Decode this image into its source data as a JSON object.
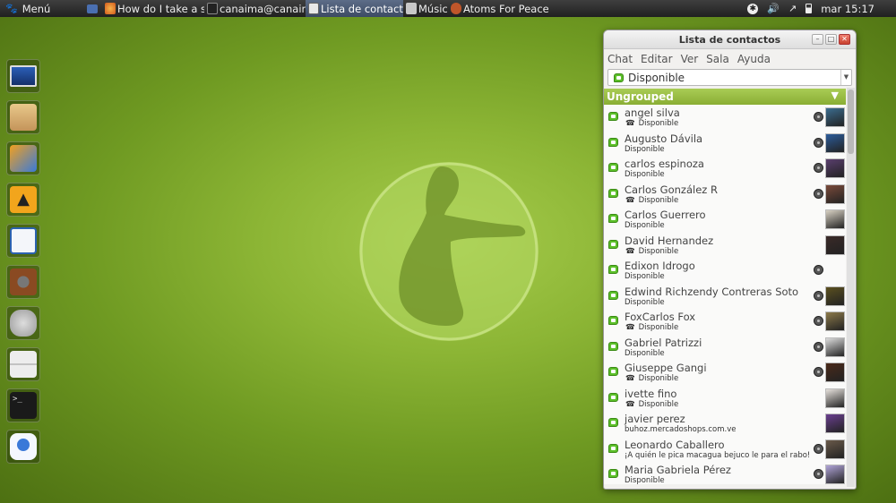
{
  "topbar": {
    "menu_label": "Menú",
    "tasks": [
      {
        "label": "How do I take a s...",
        "icon": "firefox-icon"
      },
      {
        "label": "canaima@canaim...",
        "icon": "terminal-icon"
      },
      {
        "label": "Lista de contactos",
        "icon": "empathy-icon",
        "active": true
      },
      {
        "label": "Música",
        "icon": "music-icon"
      },
      {
        "label": "Atoms For Peace...",
        "icon": "music-player-icon"
      }
    ],
    "clock": "mar 15:17"
  },
  "launcher": [
    {
      "name": "display-settings"
    },
    {
      "name": "home-folder"
    },
    {
      "name": "file-manager"
    },
    {
      "name": "twitter-client"
    },
    {
      "name": "writer-document"
    },
    {
      "name": "music-speaker"
    },
    {
      "name": "trash"
    },
    {
      "name": "filing-cabinet"
    },
    {
      "name": "terminal"
    },
    {
      "name": "messenger"
    }
  ],
  "window": {
    "title": "Lista de contactos",
    "menu": {
      "chat": "Chat",
      "edit": "Editar",
      "view": "Ver",
      "room": "Sala",
      "help": "Ayuda"
    },
    "status": "Disponible",
    "group": "Ungrouped",
    "contacts": [
      {
        "name": "angel silva",
        "status": "Disponible",
        "phone": true,
        "cam": true,
        "avatar": "#3b6d8f"
      },
      {
        "name": "Augusto Dávila",
        "status": "Disponible",
        "phone": false,
        "cam": true,
        "avatar": "#2c5c9a"
      },
      {
        "name": "carlos espinoza",
        "status": "Disponible",
        "phone": false,
        "cam": true,
        "avatar": "#5a3f6e"
      },
      {
        "name": "Carlos González R",
        "status": "Disponible",
        "phone": true,
        "cam": true,
        "avatar": "#7a4a3a"
      },
      {
        "name": "Carlos Guerrero",
        "status": "Disponible",
        "phone": false,
        "cam": false,
        "avatar": "#d9d2c4"
      },
      {
        "name": "David Hernandez",
        "status": "Disponible",
        "phone": true,
        "cam": false,
        "avatar": "#3a2a28"
      },
      {
        "name": "Edixon Idrogo",
        "status": "Disponible",
        "phone": false,
        "cam": true,
        "avatar": ""
      },
      {
        "name": "Edwind Richzendy Contreras Soto",
        "status": "Disponible",
        "phone": false,
        "cam": true,
        "avatar": "#5b5020"
      },
      {
        "name": "FoxCarlos Fox",
        "status": "Disponible",
        "phone": true,
        "cam": true,
        "avatar": "#8c7a4a"
      },
      {
        "name": "Gabriel Patrizzi",
        "status": "Disponible",
        "phone": false,
        "cam": true,
        "avatar": "#dddddd"
      },
      {
        "name": "Giuseppe Gangi",
        "status": "Disponible",
        "phone": true,
        "cam": true,
        "avatar": "#4a2a1a"
      },
      {
        "name": "ivette fino",
        "status": "Disponible",
        "phone": true,
        "cam": false,
        "avatar": "#e6e1dc"
      },
      {
        "name": "javier perez",
        "status": "buhoz.mercadoshops.com.ve",
        "phone": false,
        "cam": false,
        "avatar": "#6a3f8f"
      },
      {
        "name": "Leonardo Caballero",
        "status": "¡A quién le pica macagua bejuco le para el rabo!",
        "phone": false,
        "cam": true,
        "avatar": "#6a5a4a"
      },
      {
        "name": "Maria Gabriela Pérez",
        "status": "Disponible",
        "phone": false,
        "cam": true,
        "avatar": "#b0a4d8"
      }
    ]
  }
}
